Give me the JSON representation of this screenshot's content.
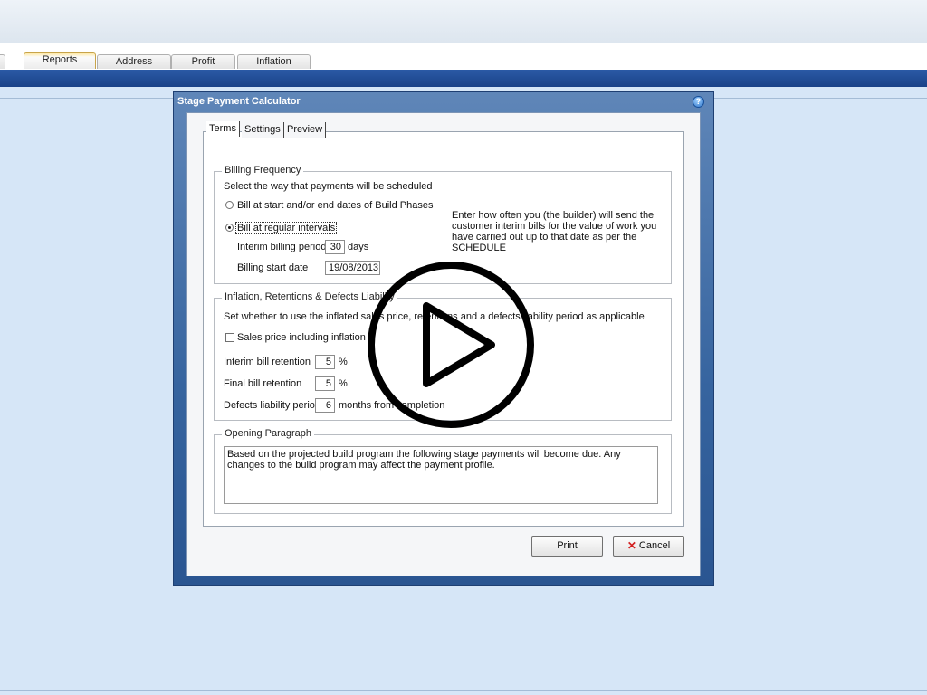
{
  "app": {
    "tabs": [
      {
        "label": "Reports"
      },
      {
        "label": "Address"
      },
      {
        "label": "Profit"
      },
      {
        "label": "Inflation"
      }
    ]
  },
  "dialog": {
    "title": "Stage Payment Calculator",
    "help_symbol": "?",
    "tabs": [
      {
        "label": "Terms"
      },
      {
        "label": "Settings"
      },
      {
        "label": "Preview"
      }
    ],
    "billing": {
      "legend": "Billing Frequency",
      "intro": "Select the way that payments will be scheduled",
      "option_build_phases": "Bill at start and/or end dates of Build Phases",
      "option_regular": "Bill at regular intervals",
      "interim_period_label": "Interim billing period",
      "interim_period_value": "30",
      "interim_period_unit": "days",
      "start_date_label": "Billing start date",
      "start_date_value": "19/08/2013",
      "note": "Enter how often you (the builder) will send the customer interim bills for the value of work you have carried out up to that date as per the SCHEDULE"
    },
    "inflation": {
      "legend": "Inflation, Retentions & Defects Liability",
      "intro": "Set whether to use the inflated sales price, retentions and a defects liability period as applicable",
      "sales_price_label": "Sales price including inflation",
      "interim_retention_label": "Interim bill retention",
      "interim_retention_value": "5",
      "final_retention_label": "Final bill retention",
      "final_retention_value": "5",
      "percent_unit": "%",
      "defects_label": "Defects liability period",
      "defects_value": "6",
      "defects_unit": "months from completion"
    },
    "opening": {
      "legend": "Opening Paragraph",
      "text": "Based on the projected build program the following stage payments will become due.  Any changes to the build program may affect the payment profile."
    },
    "buttons": {
      "print": "Print",
      "cancel": "Cancel"
    }
  }
}
